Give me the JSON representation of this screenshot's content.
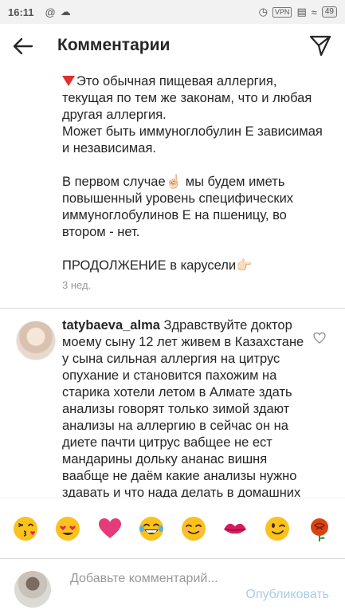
{
  "status_bar": {
    "time": "16:11",
    "vpn_label": "VPN",
    "battery": "49"
  },
  "header": {
    "title": "Комментарии"
  },
  "caption": {
    "p1": "Это обычная пищевая аллергия, текущая по тем же законам, что и любая другая аллергия.\nМожет быть иммуноглобулин Е зависимая и независимая.",
    "p2": "В первом случае☝🏻 мы будем иметь повышенный уровень специфических иммуноглобулинов Е на пшеницу, во втором - нет.",
    "p3": "ПРОДОЛЖЕНИЕ в карусели👉🏻",
    "timestamp": "3 нед."
  },
  "comment": {
    "username": "tatybaeva_alma",
    "text": "Здравствуйте доктор моему сыну 12 лет  живем в Казахстане у сына сильная аллергия на цитрус опухание и становится пахожим на старика хотели летом в Алмате здать анализы говорят только зимой здают анализы на аллергию в сейчас он на диете пачти цитрус вабщее не ест мандарины дольку ананас вишня ваабще не даём какие анализы нужно здавать и что нада делать в домашних"
  },
  "emoji_bar": {
    "items": [
      "😘",
      "😍",
      "❤️",
      "😂",
      "😊",
      "💋",
      "😉",
      "🌹"
    ]
  },
  "input": {
    "placeholder": "Добавьте комментарий...",
    "publish_label": "Опубликовать"
  }
}
